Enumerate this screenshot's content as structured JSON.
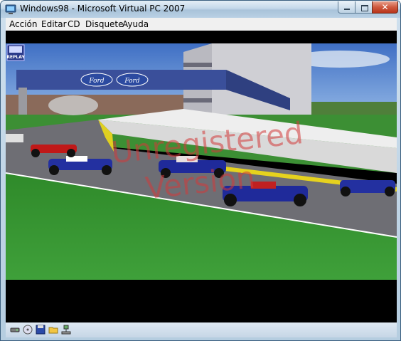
{
  "window": {
    "title": "Windows98 - Microsoft Virtual PC 2007",
    "close_glyph": "✕"
  },
  "menu": {
    "items": [
      "Acción",
      "Editar",
      "CD",
      "Disquete",
      "Ayuda"
    ]
  },
  "game": {
    "replay_label": "REPLAY",
    "sponsor_banner": [
      "Ford",
      "Ford"
    ],
    "watermark_lines": [
      "Unregistered",
      "Version"
    ]
  },
  "statusbar": {
    "icons": [
      "hard-disk-icon",
      "cd-drive-icon",
      "floppy-icon",
      "shared-folder-icon",
      "network-icon"
    ]
  },
  "colors": {
    "titlebar": "#b9d0e4",
    "menubar": "#f0f0f0",
    "screen_bg": "#000000",
    "watermark": "#d23a3a"
  }
}
